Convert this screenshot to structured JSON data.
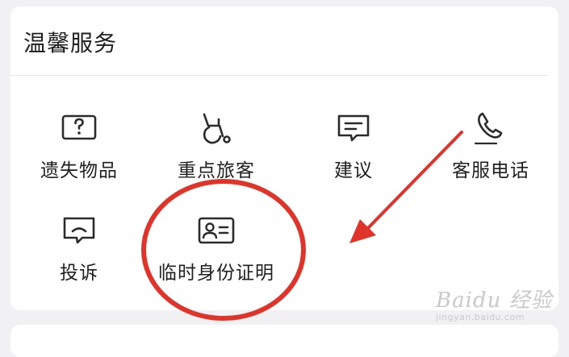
{
  "section": {
    "title": "温馨服务",
    "items": [
      {
        "label": "遗失物品",
        "icon": "question-box-icon"
      },
      {
        "label": "重点旅客",
        "icon": "wheelchair-icon"
      },
      {
        "label": "建议",
        "icon": "message-icon"
      },
      {
        "label": "客服电话",
        "icon": "phone-icon"
      },
      {
        "label": "投诉",
        "icon": "complaint-message-icon"
      },
      {
        "label": "临时身份证明",
        "icon": "id-card-icon"
      }
    ]
  },
  "watermark": {
    "brand": "Baidu 经验",
    "url": "jingyan.baidu.com"
  },
  "colors": {
    "annotation": "#e0332a",
    "card": "#ffffff",
    "background": "#f1f1f3",
    "text": "#1f1f1f",
    "icon": "#2b2b2b"
  }
}
